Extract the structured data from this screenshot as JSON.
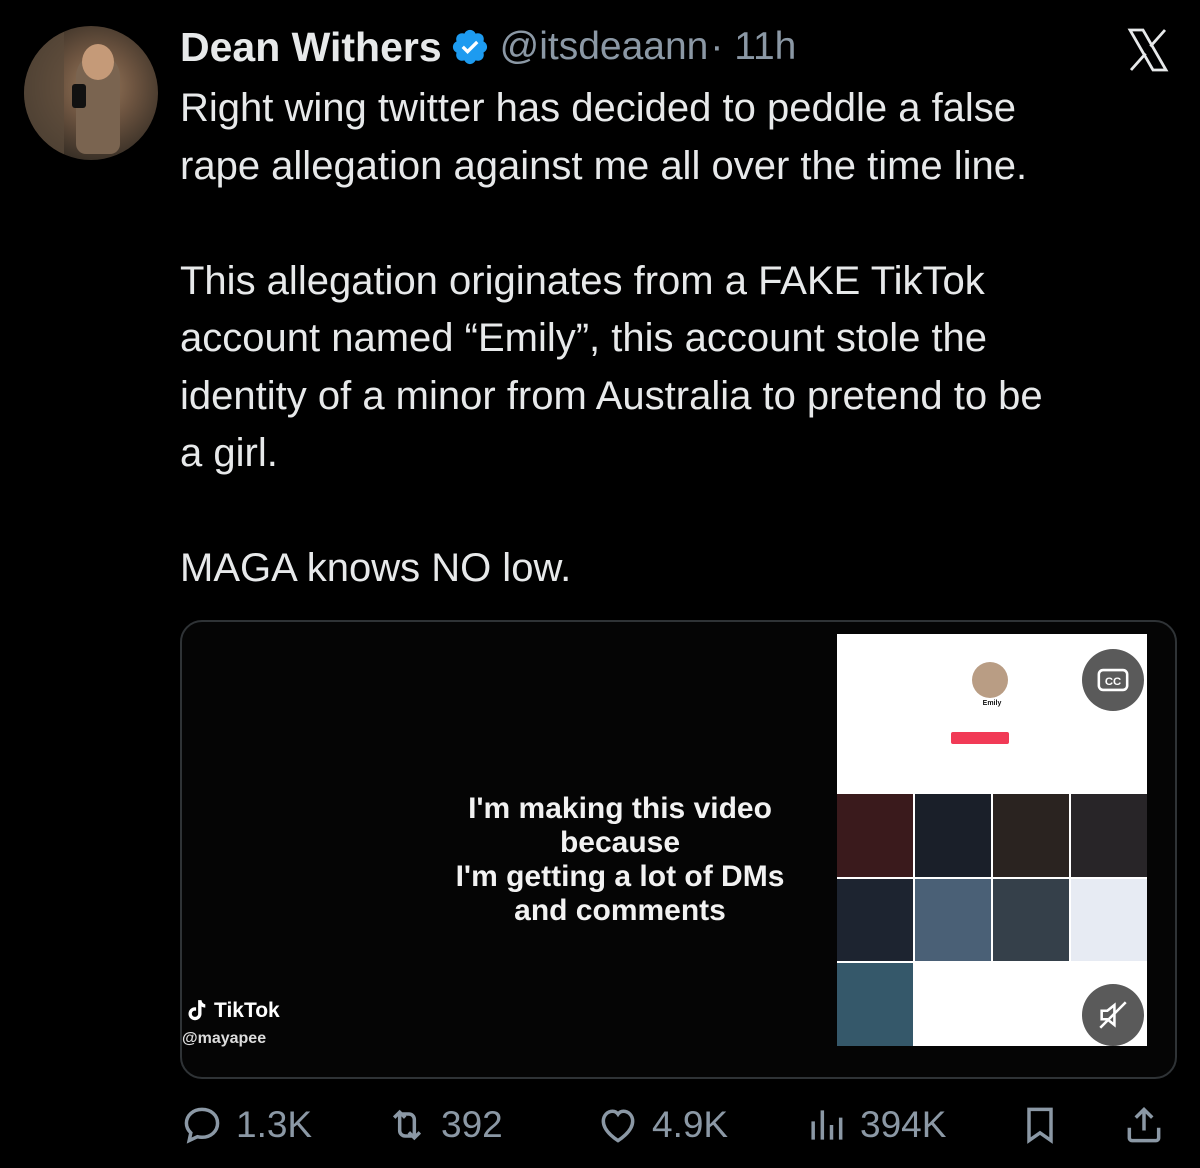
{
  "tweet": {
    "author_name": "Dean Withers",
    "handle": "@itsdeaann",
    "time": "· 11h",
    "text_lines": [
      "Right wing twitter has decided to peddle a false",
      "rape allegation against me all over the time line.",
      "",
      "This allegation originates from a FAKE TikTok",
      "account named “Emily”, this account stole the",
      "identity of a minor from Australia to pretend to be",
      "a girl.",
      "",
      "MAGA knows NO low."
    ]
  },
  "media": {
    "caption_lines": [
      "I'm making this video because",
      "I'm getting a lot of DMs",
      "and comments"
    ],
    "tiktok_label": "TikTok",
    "tiktok_user": "@mayapee",
    "profile_name": "Emily"
  },
  "actions": {
    "replies": "1.3K",
    "reposts": "392",
    "likes": "4.9K",
    "views": "394K"
  },
  "colors": {
    "background": "#000000",
    "text": "#e7e9ea",
    "muted": "#8b98a5",
    "verified": "#1d9bf0"
  },
  "icons": [
    "verified-badge-icon",
    "x-logo-icon",
    "reply-icon",
    "repost-icon",
    "like-icon",
    "views-icon",
    "bookmark-icon",
    "share-icon",
    "cc-icon",
    "mute-icon",
    "tiktok-logo-icon"
  ]
}
